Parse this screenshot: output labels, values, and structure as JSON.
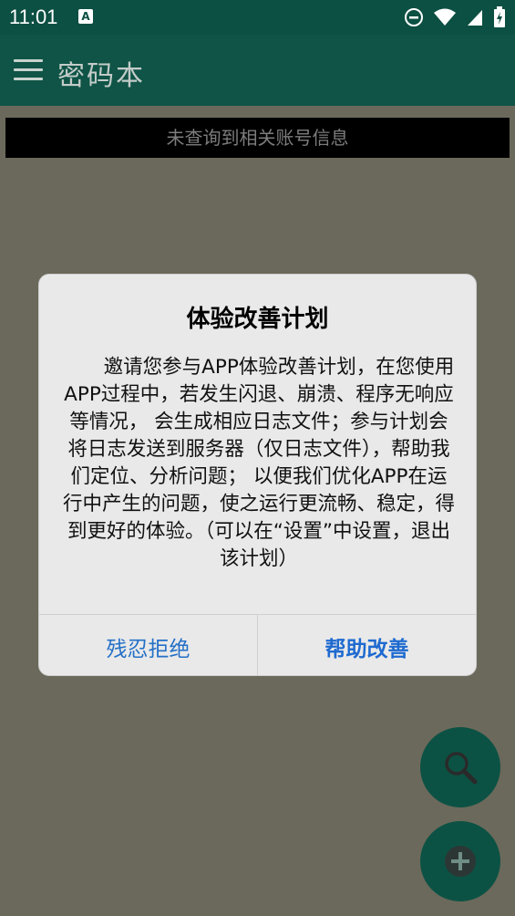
{
  "status_bar": {
    "time": "11:01",
    "notification": "A"
  },
  "app_bar": {
    "title": "密码本"
  },
  "banner": {
    "text": "未查询到相关账号信息"
  },
  "dialog": {
    "title": "体验改善计划",
    "body": "邀请您参与APP体验改善计划，在您使用APP过程中，若发生闪退、崩溃、程序无响应等情况， 会生成相应日志文件；参与计划会将日志发送到服务器（仅日志文件），帮助我们定位、分析问题； 以便我们优化APP在运行中产生的问题，使之运行更流畅、稳定，得到更好的体验。（可以在“设置”中设置，退出该计划）",
    "decline_label": "残忍拒绝",
    "accept_label": "帮助改善"
  },
  "fabs": {
    "search_icon": "search-icon",
    "add_icon": "add-icon"
  },
  "colors": {
    "primary": "#0f5446",
    "accent": "#1e6ad0",
    "scrim": "#6b695b"
  }
}
